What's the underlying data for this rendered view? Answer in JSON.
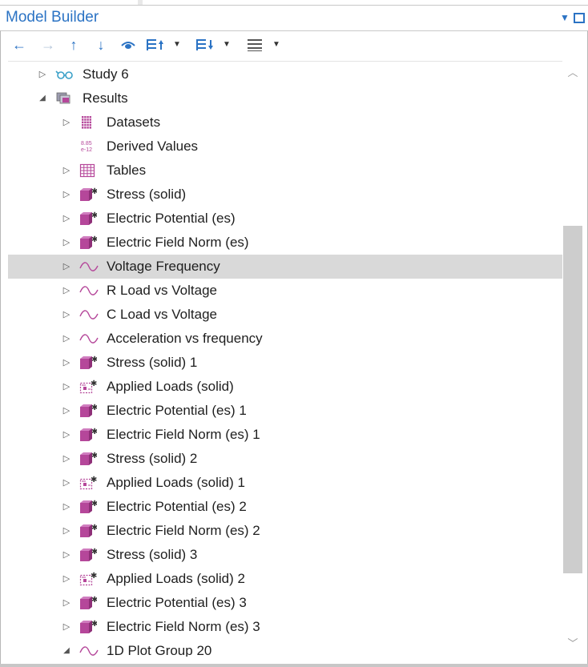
{
  "header": {
    "title": "Model Builder",
    "menu_icon": "dropdown-triangle-icon",
    "maximize_icon": "maximize-icon"
  },
  "toolbar": {
    "buttons": [
      {
        "icon": "arrow-left-icon",
        "glyph": "←",
        "enabled": true
      },
      {
        "icon": "arrow-right-icon",
        "glyph": "→",
        "enabled": false
      },
      {
        "icon": "arrow-up-icon",
        "glyph": "↑",
        "enabled": true
      },
      {
        "icon": "arrow-down-icon",
        "glyph": "↓",
        "enabled": true
      },
      {
        "icon": "show-icon",
        "glyph": "👁",
        "enabled": true
      },
      {
        "icon": "expand-all-icon",
        "glyph": "☰",
        "enabled": true
      },
      {
        "icon": "sort-icon",
        "glyph": "☰",
        "enabled": true
      },
      {
        "icon": "list-view-icon",
        "glyph": "☰",
        "enabled": true
      }
    ]
  },
  "tree": {
    "selected_index": 8,
    "items": [
      {
        "label": "Study 6",
        "level": 0,
        "toggle": "collapsed",
        "icon": "study-icon"
      },
      {
        "label": "Results",
        "level": 0,
        "toggle": "expanded",
        "icon": "results-icon"
      },
      {
        "label": "Datasets",
        "level": 1,
        "toggle": "collapsed",
        "icon": "datasets-icon"
      },
      {
        "label": "Derived Values",
        "level": 1,
        "toggle": "none",
        "icon": "derived-values-icon",
        "icon_text": "8.85\ne-12"
      },
      {
        "label": "Tables",
        "level": 1,
        "toggle": "collapsed",
        "icon": "tables-icon"
      },
      {
        "label": "Stress (solid)",
        "level": 1,
        "toggle": "collapsed",
        "icon": "3d-plot-group-icon"
      },
      {
        "label": "Electric Potential (es)",
        "level": 1,
        "toggle": "collapsed",
        "icon": "3d-plot-group-icon"
      },
      {
        "label": "Electric Field Norm (es)",
        "level": 1,
        "toggle": "collapsed",
        "icon": "3d-plot-group-icon"
      },
      {
        "label": "Voltage Frequency",
        "level": 1,
        "toggle": "collapsed",
        "icon": "1d-plot-group-icon"
      },
      {
        "label": "R Load vs Voltage",
        "level": 1,
        "toggle": "collapsed",
        "icon": "1d-plot-group-icon"
      },
      {
        "label": "C Load vs Voltage",
        "level": 1,
        "toggle": "collapsed",
        "icon": "1d-plot-group-icon"
      },
      {
        "label": "Acceleration vs frequency",
        "level": 1,
        "toggle": "collapsed",
        "icon": "1d-plot-group-icon"
      },
      {
        "label": "Stress (solid) 1",
        "level": 1,
        "toggle": "collapsed",
        "icon": "3d-plot-group-icon"
      },
      {
        "label": "Applied Loads (solid)",
        "level": 1,
        "toggle": "collapsed",
        "icon": "applied-loads-icon"
      },
      {
        "label": "Electric Potential (es) 1",
        "level": 1,
        "toggle": "collapsed",
        "icon": "3d-plot-group-icon"
      },
      {
        "label": "Electric Field Norm (es) 1",
        "level": 1,
        "toggle": "collapsed",
        "icon": "3d-plot-group-icon"
      },
      {
        "label": "Stress (solid) 2",
        "level": 1,
        "toggle": "collapsed",
        "icon": "3d-plot-group-icon"
      },
      {
        "label": "Applied Loads (solid) 1",
        "level": 1,
        "toggle": "collapsed",
        "icon": "applied-loads-icon"
      },
      {
        "label": "Electric Potential (es) 2",
        "level": 1,
        "toggle": "collapsed",
        "icon": "3d-plot-group-icon"
      },
      {
        "label": "Electric Field Norm (es) 2",
        "level": 1,
        "toggle": "collapsed",
        "icon": "3d-plot-group-icon"
      },
      {
        "label": "Stress (solid) 3",
        "level": 1,
        "toggle": "collapsed",
        "icon": "3d-plot-group-icon"
      },
      {
        "label": "Applied Loads (solid) 2",
        "level": 1,
        "toggle": "collapsed",
        "icon": "applied-loads-icon"
      },
      {
        "label": "Electric Potential (es) 3",
        "level": 1,
        "toggle": "collapsed",
        "icon": "3d-plot-group-icon"
      },
      {
        "label": "Electric Field Norm (es) 3",
        "level": 1,
        "toggle": "collapsed",
        "icon": "3d-plot-group-icon"
      },
      {
        "label": "1D Plot Group 20",
        "level": 1,
        "toggle": "expanded",
        "icon": "1d-plot-group-icon"
      }
    ]
  },
  "colors": {
    "accent_blue": "#2b73c4",
    "plot_magenta": "#b5479a",
    "selection_gray": "#d9d9d9",
    "scrollbar_thumb": "#cdcdcd"
  }
}
